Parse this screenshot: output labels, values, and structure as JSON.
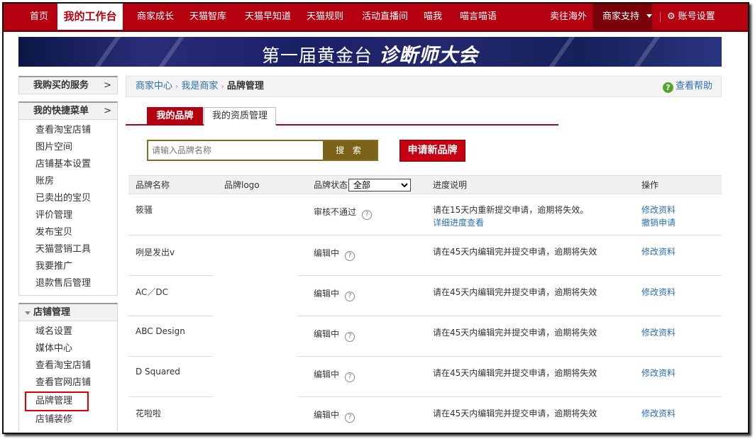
{
  "topnav": {
    "items": [
      "首页",
      "我的工作台",
      "商家成长",
      "天猫智库",
      "天猫早知道",
      "天猫规则",
      "活动直播间",
      "喵我",
      "喵言喵语"
    ],
    "right": [
      "卖往海外",
      "商家支持",
      "账号设置"
    ]
  },
  "banner": {
    "prefix": "第一届黄金台",
    "suffix": "诊断师大会"
  },
  "sidebar": {
    "sections": [
      {
        "title": "我购买的服务",
        "arrow": ">",
        "items": []
      },
      {
        "title": "我的快捷菜单",
        "arrow": ">",
        "items": [
          "查看淘宝店铺",
          "图片空间",
          "店铺基本设置",
          "账房",
          "已卖出的宝贝",
          "评价管理",
          "发布宝贝",
          "天猫营销工具",
          "我要推广",
          "退款售后管理"
        ]
      },
      {
        "title": "店铺管理",
        "items": [
          "域名设置",
          "媒体中心",
          "查看淘宝店铺",
          "查看官网店铺",
          "品牌管理",
          "店铺装修"
        ]
      }
    ]
  },
  "breadcrumb": {
    "items": [
      "商家中心",
      "我是商家",
      "品牌管理"
    ],
    "separator": "›",
    "help": "查看帮助"
  },
  "tabs": [
    "我的品牌",
    "我的资质管理"
  ],
  "search": {
    "placeholder": "请输入品牌名称",
    "button": "搜 索"
  },
  "apply_button": "申请新品牌",
  "table": {
    "headers": {
      "name": "品牌名称",
      "logo": "品牌logo",
      "status": "品牌状态",
      "progress": "进度说明",
      "action": "操作"
    },
    "status_filter": "全部",
    "rows": [
      {
        "name": "筱骚",
        "status": "审核不通过",
        "progress": "请在15天内重新提交申请，逾期将失效。",
        "progress_link": "详细进度查看",
        "actions": [
          "修改资料",
          "撤销申请"
        ]
      },
      {
        "name": "咧是发出v",
        "status": "编辑中",
        "progress": "请在45天内编辑完并提交申请，逾期将失效",
        "progress_link": "",
        "actions": [
          "修改资料"
        ]
      },
      {
        "name": "AC／DC",
        "status": "编辑中",
        "progress": "请在45天内编辑完并提交申请，逾期将失效",
        "progress_link": "",
        "actions": [
          "修改资料"
        ]
      },
      {
        "name": "ABC Design",
        "status": "编辑中",
        "progress": "请在45天内编辑完并提交申请，逾期将失效",
        "progress_link": "",
        "actions": [
          "修改资料"
        ]
      },
      {
        "name": "D Squared",
        "status": "编辑中",
        "progress": "请在45天内编辑完并提交申请，逾期将失效",
        "progress_link": "",
        "actions": [
          "修改资料"
        ]
      },
      {
        "name": "花啦啦",
        "status": "编辑中",
        "progress": "请在45天内编辑完并提交申请，逾期将失效",
        "progress_link": "",
        "actions": [
          "修改资料"
        ]
      }
    ]
  }
}
